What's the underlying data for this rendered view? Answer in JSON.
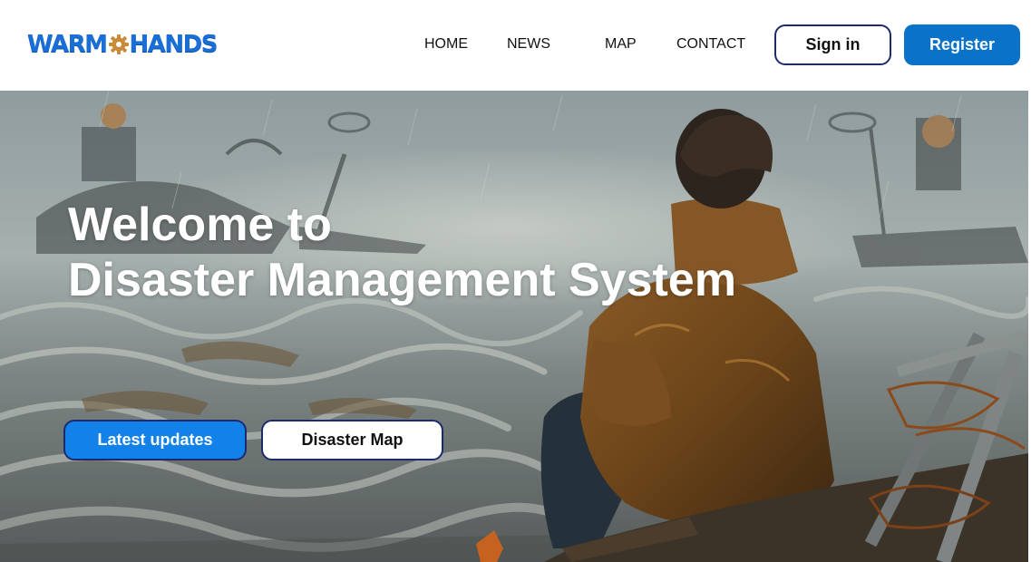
{
  "header": {
    "logo": {
      "part1": "WARM",
      "part2": "HANDS",
      "icon": "gear-icon"
    },
    "nav": [
      {
        "id": "home",
        "label": "HOME"
      },
      {
        "id": "news",
        "label": "NEWS"
      },
      {
        "id": "map",
        "label": "MAP"
      },
      {
        "id": "contact",
        "label": "CONTACT"
      }
    ],
    "signin_label": "Sign in",
    "register_label": "Register"
  },
  "hero": {
    "title_line1": "Welcome to",
    "title_line2": "Disaster Management System",
    "latest_label": "Latest updates",
    "map_label": "Disaster Map",
    "image_description_icon": "flood-scene-image"
  },
  "colors": {
    "brand_blue": "#1a6fd6",
    "register_bg": "#0a72c8",
    "latest_bg": "#1282ea",
    "button_border": "#1d2b6e",
    "gear_orange": "#c98a3a"
  }
}
